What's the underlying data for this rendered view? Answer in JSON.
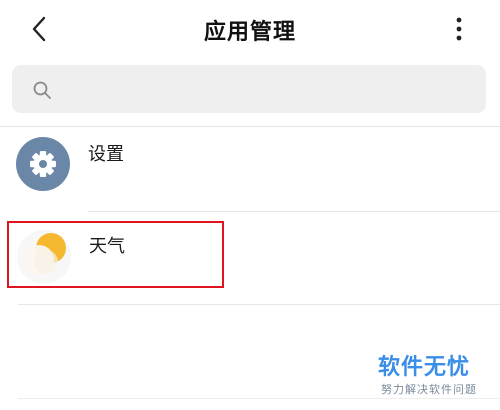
{
  "header": {
    "back_icon": "chevron-left-icon",
    "title": "应用管理",
    "more_icon": "more-vertical-icon"
  },
  "search": {
    "icon": "search-icon",
    "placeholder": "",
    "value": ""
  },
  "apps": [
    {
      "label": "设置",
      "icon": "gear-icon",
      "icon_color": "#6b87a8"
    },
    {
      "label": "天气",
      "icon": "weather-sun-cloud-icon",
      "icon_color": "#f5b82e",
      "highlighted": true
    }
  ],
  "annotation": {
    "color": "#e0141e"
  },
  "watermark": {
    "title": "软件无忧",
    "subtitle": "努力解决软件问题",
    "color": "#3a8ee8"
  }
}
